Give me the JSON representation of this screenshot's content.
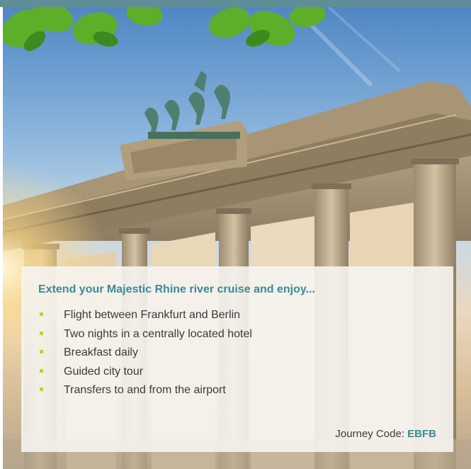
{
  "brand_color": "#5f8e96",
  "accent_color": "#3a8a98",
  "bullet_color": "#c3cf2c",
  "offer": {
    "headline": "Extend your Majestic Rhine river cruise and enjoy...",
    "features": [
      "Flight between Frankfurt and Berlin",
      "Two nights in a centrally located hotel",
      "Breakfast daily",
      "Guided city tour",
      "Transfers to and from the airport"
    ],
    "journey_code_label": "Journey Code:",
    "journey_code": "EBFB"
  }
}
